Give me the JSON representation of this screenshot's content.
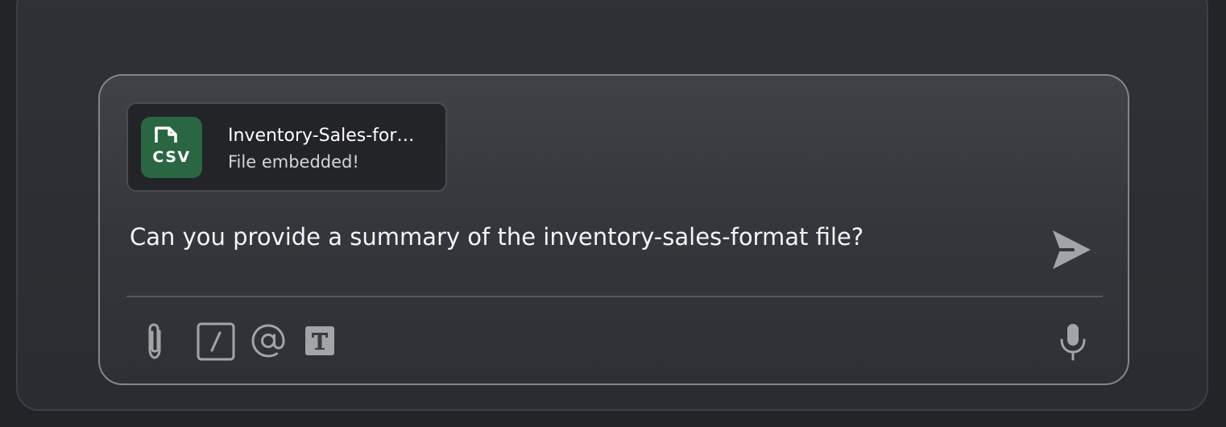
{
  "attachment": {
    "file_type": "CSV",
    "file_name": "Inventory-Sales-format.csv",
    "file_name_display": "Inventory-Sales-for…",
    "status": "File embedded!",
    "thumb_color": "#2b6643"
  },
  "message": {
    "text": "Can you provide a summary of the inventory-sales-format file?"
  },
  "toolbar": {
    "icons": [
      "paperclip-icon",
      "slash-command-icon",
      "at-mention-icon",
      "text-format-icon"
    ],
    "mic_icon": "microphone-icon",
    "send_icon": "send-icon"
  },
  "colors": {
    "background": "#232428",
    "panel": "#2e3035",
    "composer_border": "#84868b",
    "icon": "#a2a4a8"
  }
}
